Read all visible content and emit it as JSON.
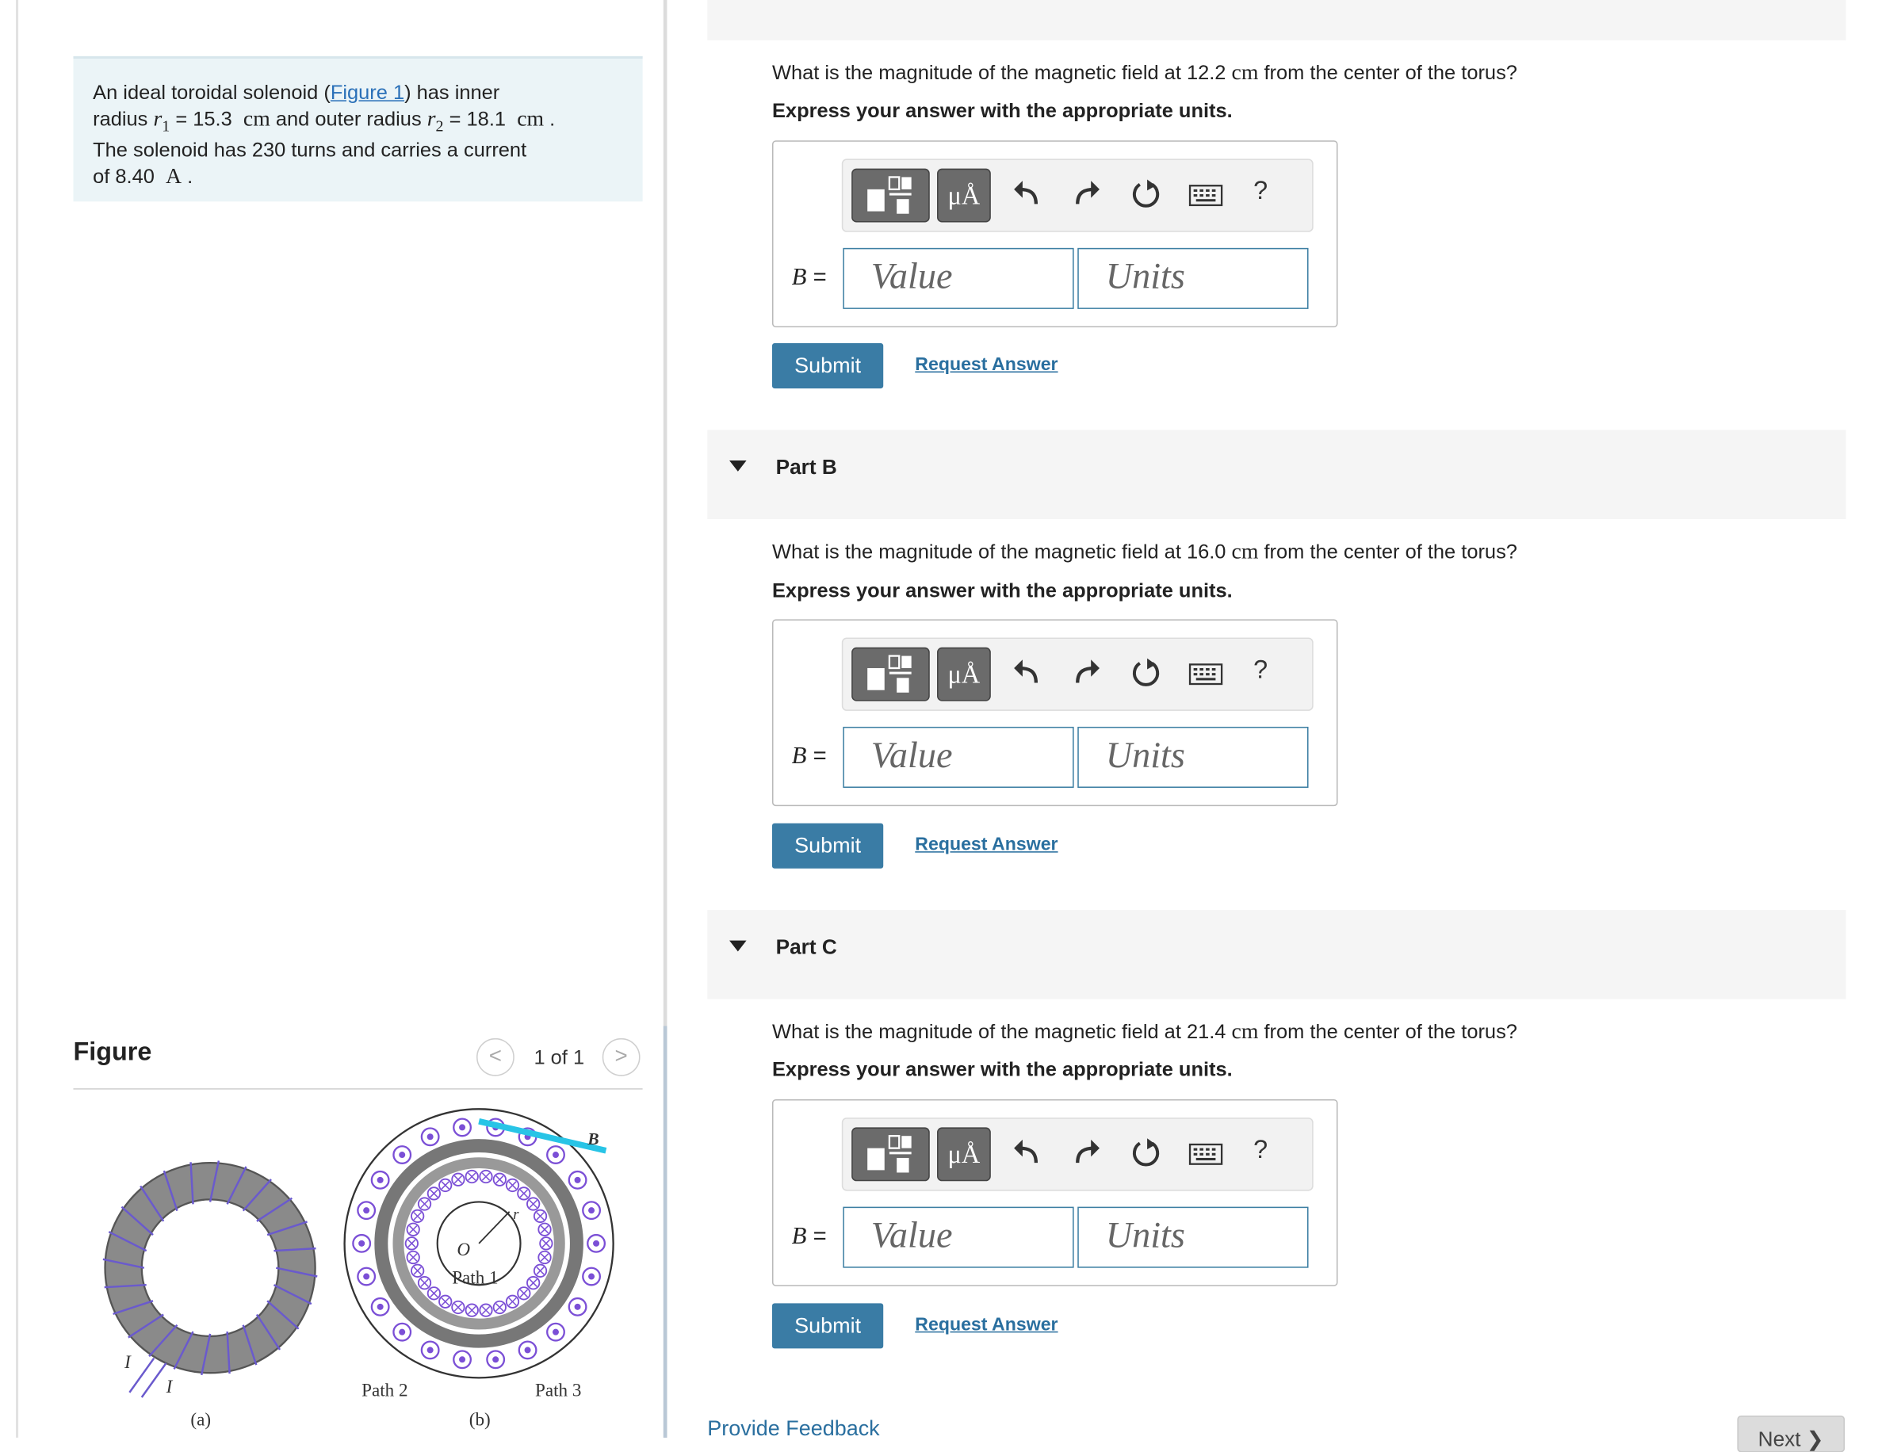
{
  "problem": {
    "text1": "An ideal toroidal solenoid (",
    "figure_link": "Figure 1",
    "text2": ") has inner",
    "text3": "radius ",
    "r1_symbol": "r",
    "r1_sub": "1",
    "r1_eq": " = 15.3 ",
    "r1_unit": "cm",
    "text4": " and outer radius ",
    "r2_symbol": "r",
    "r2_sub": "2",
    "r2_eq": " = 18.1 ",
    "r2_unit": "cm",
    "text5": " .",
    "text6": "The solenoid has 230 turns and carries a current",
    "text7": "of 8.40 ",
    "current_unit": "A",
    "text8": " ."
  },
  "figure": {
    "title": "Figure",
    "prev": "<",
    "next": ">",
    "count": "1 of 1",
    "label_a": "(a)",
    "label_b": "(b)",
    "label_I1": "I",
    "label_I2": "I",
    "label_path1": "Path 1",
    "label_path2": "Path 2",
    "label_path3": "Path 3",
    "label_O": "O",
    "label_r": "r",
    "label_B": "B"
  },
  "parts": {
    "a": {
      "question_pre": "What is the magnitude of the magnetic field at 12.2 ",
      "question_unit": "cm",
      "question_post": " from the center of the torus?",
      "instruction": "Express your answer with the appropriate units.",
      "var_label": "B =",
      "value_placeholder": "Value",
      "units_placeholder": "Units",
      "submit": "Submit",
      "request": "Request Answer"
    },
    "b": {
      "title": "Part B",
      "question_pre": "What is the magnitude of the magnetic field at 16.0 ",
      "question_unit": "cm",
      "question_post": " from the center of the torus?",
      "instruction": "Express your answer with the appropriate units.",
      "var_label": "B =",
      "value_placeholder": "Value",
      "units_placeholder": "Units",
      "submit": "Submit",
      "request": "Request Answer"
    },
    "c": {
      "title": "Part C",
      "question_pre": "What is the magnitude of the magnetic field at 21.4 ",
      "question_unit": "cm",
      "question_post": " from the center of the torus?",
      "instruction": "Express your answer with the appropriate units.",
      "var_label": "B =",
      "value_placeholder": "Value",
      "units_placeholder": "Units",
      "submit": "Submit",
      "request": "Request Answer"
    }
  },
  "toolbar": {
    "mu_label": "μÅ",
    "help": "?",
    "icons": [
      "templates-icon",
      "units-icon",
      "undo-icon",
      "redo-icon",
      "reset-icon",
      "keyboard-icon",
      "help-icon"
    ]
  },
  "footer": {
    "feedback": "Provide Feedback",
    "next": "Next ❯"
  }
}
